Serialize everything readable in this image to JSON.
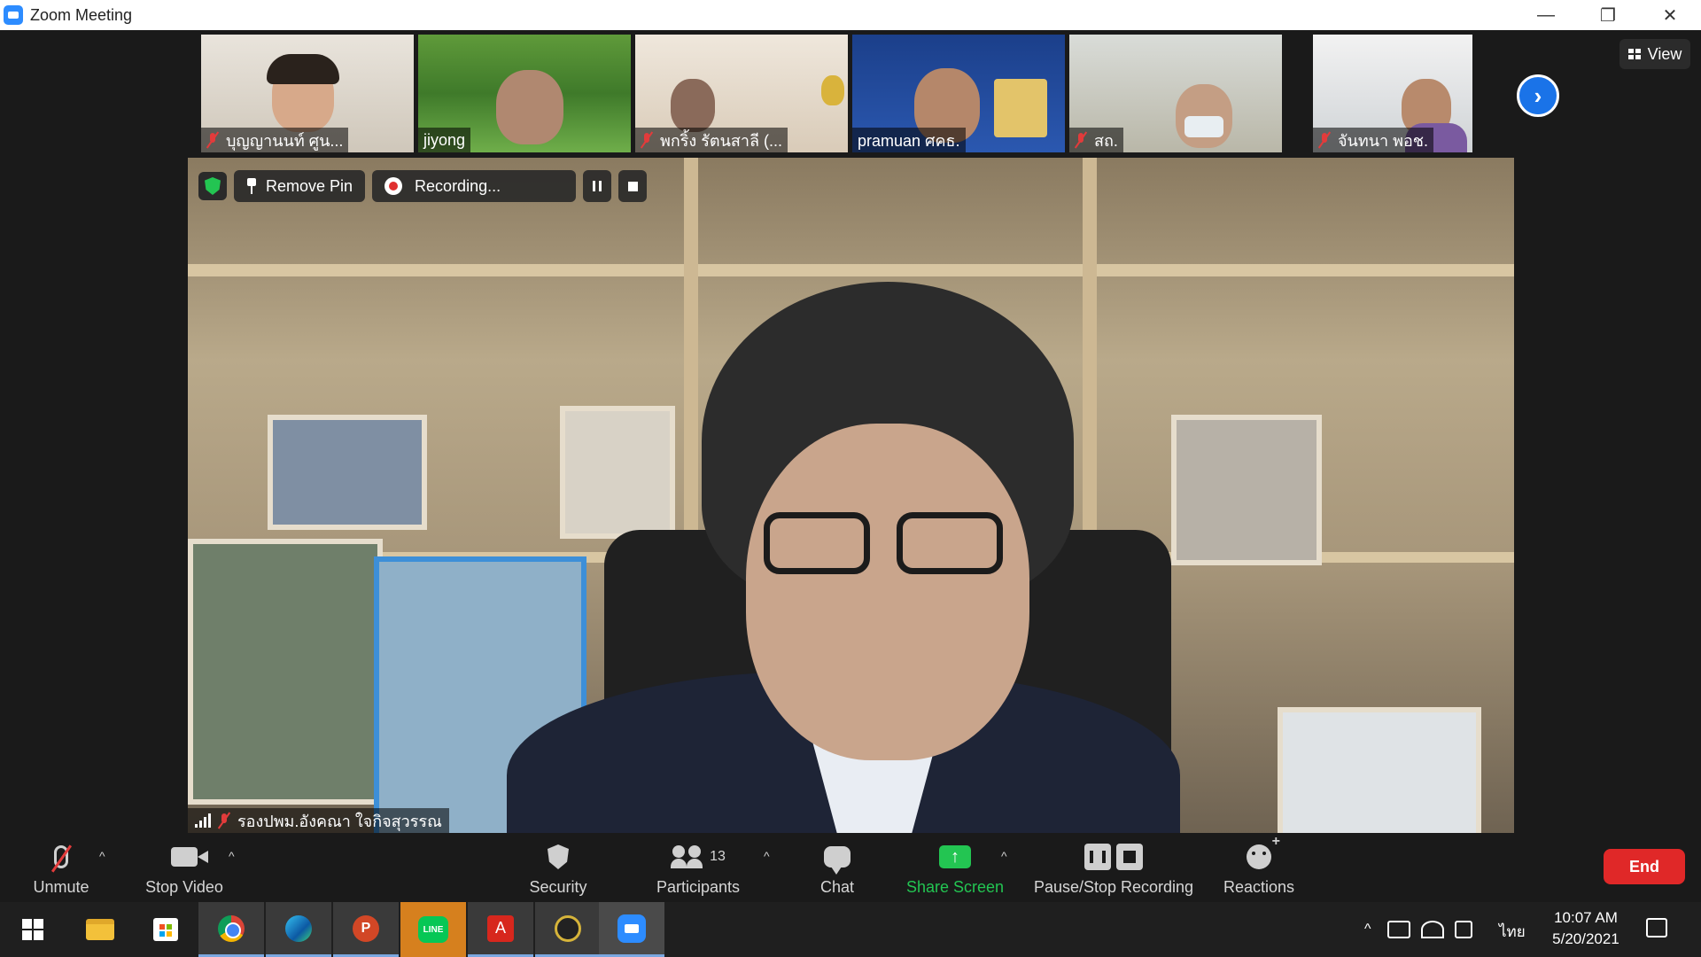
{
  "window": {
    "title": "Zoom Meeting",
    "minimize": "—",
    "restore": "❐",
    "close": "✕"
  },
  "thumbnails": [
    {
      "name": "บุญญานนท์ ศูน...",
      "muted": true
    },
    {
      "name": "jiyong",
      "muted": false
    },
    {
      "name": "พกริ้ง รัตนสาลี (...",
      "muted": true
    },
    {
      "name": "pramuan ศคธ.",
      "muted": false
    },
    {
      "name": "สถ.",
      "muted": true
    },
    {
      "name": "จันทนา พอช.",
      "muted": true
    }
  ],
  "view_button": {
    "label": "View"
  },
  "next_button": {
    "label": "›"
  },
  "main_video": {
    "speaker_name": "รองปพม.อังคณา ใจกิจสุวรรณ",
    "remove_pin_label": "Remove Pin",
    "recording_label": "Recording..."
  },
  "toolbar": {
    "unmute": "Unmute",
    "stop_video": "Stop Video",
    "security": "Security",
    "participants": "Participants",
    "participants_count": "13",
    "chat": "Chat",
    "share_screen": "Share Screen",
    "pause_stop_recording": "Pause/Stop Recording",
    "reactions": "Reactions",
    "end": "End",
    "caret": "^",
    "share_arrow": "↑"
  },
  "taskbar": {
    "apps": [
      "start",
      "file-explorer",
      "microsoft-store",
      "chrome",
      "edge",
      "powerpoint",
      "line",
      "acrobat",
      "app",
      "zoom"
    ],
    "line_label": "LINE",
    "ppt_label": "P",
    "acrobat_label": "A",
    "tray_up": "^",
    "language": "ไทย",
    "time": "10:07 AM",
    "date": "5/20/2021"
  },
  "colors": {
    "accent_blue": "#2d8cff",
    "share_green": "#23c552",
    "end_red": "#e02828",
    "mute_red": "#e23b3b"
  }
}
